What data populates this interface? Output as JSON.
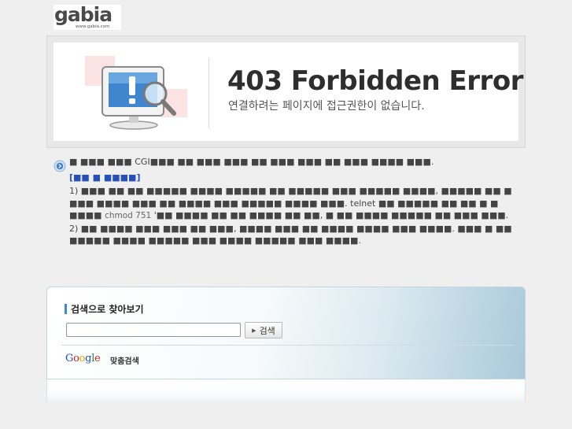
{
  "logo": {
    "mark": "gabia",
    "url": "www.gabia.com"
  },
  "banner": {
    "title": "403 Forbidden Error",
    "subtitle": "연결하려는 페이지에 접근권한이 없습니다."
  },
  "info": {
    "line1": "■ ■■■ ■■■ CGI■■■ ■■ ■■■ ■■■ ■■ ■■■ ■■■ ■■ ■■■ ■■■■ ■■■.",
    "link": "[■■ ■ ■■■■]",
    "item1_a": "1) ■■■ ■■ ■■ ■■■■■ ■■■■ ■■■■■ ■■ ■■■■■ ■■■ ■■■■■ ■■■■, ■■■■■ ■■ ■ ■■■ ■■■■ ■■■ ■■ ■■■■ ■■■ ■■■■■ ■■■■ ■■■. telnet ■■ ■■■■■ ■■ ■■ ■ ■ ■■■■",
    "item1_cmd": "chmod 751",
    "item1_b": "'■■ ■■■■ ■■ ■■ ■■■■ ■■ ■■, ■ ■■ ■■■■ ■■■■■ ■■ ■■■ ■■■.",
    "item2": "2) ■■ ■■■■ ■■■ ■■■ ■■ ■■■, ■■■■ ■■■ ■■ ■■■■ ■■■■ ■■■ ■■■■. ■■■ ■ ■■ ■■■■■ ■■■■ ■■■■■ ■■■ ■■■■ ■■■■■ ■■■ ■■■■."
  },
  "search": {
    "title": "검색으로 찾아보기",
    "input_value": "",
    "placeholder": "",
    "button_label": "검색",
    "google_sub": "맞춤검색",
    "google_letters": [
      "G",
      "o",
      "o",
      "g",
      "l",
      "e"
    ]
  },
  "colors": {
    "link": "#2551b8",
    "accent_blue": "#3c8ad0",
    "panel_blue": "#a9c9da"
  }
}
